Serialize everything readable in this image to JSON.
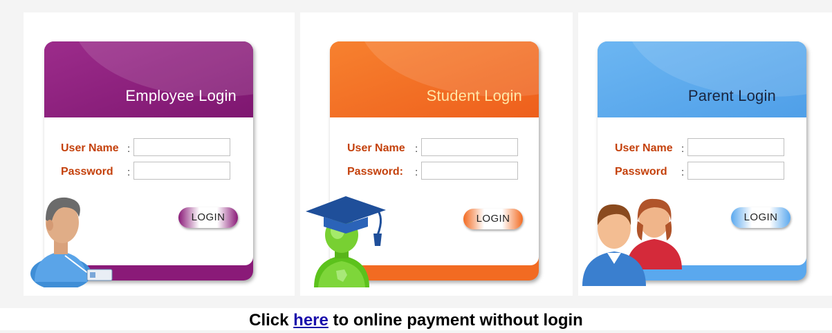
{
  "employee": {
    "title": "Employee Login",
    "username_label": "User Name",
    "password_label": "Password",
    "colon": ":",
    "username_value": "",
    "password_value": "",
    "login_label": "LOGIN",
    "accent": "#8a1a78"
  },
  "student": {
    "title": "Student Login",
    "username_label": "User Name",
    "password_label": "Password:",
    "colon": ":",
    "username_value": "",
    "password_value": "",
    "login_label": "LOGIN",
    "accent": "#f26b22"
  },
  "parent": {
    "title": "Parent Login",
    "username_label": "User Name",
    "password_label": "Password",
    "colon": ":",
    "username_value": "",
    "password_value": "",
    "login_label": "LOGIN",
    "accent": "#5aa8ee"
  },
  "footer": {
    "prefix": "Click ",
    "link": "here",
    "suffix": " to online payment without login"
  },
  "label_color": "#c4410c"
}
